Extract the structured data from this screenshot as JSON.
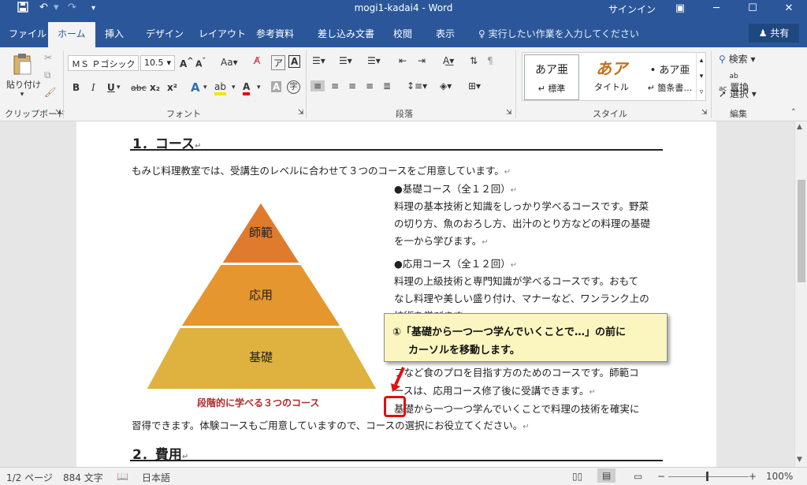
{
  "titlebar": {
    "doc_title": "mogi1-kadai4  -  Word",
    "signin": "サインイン"
  },
  "tabs": [
    "ファイル",
    "ホーム",
    "挿入",
    "デザイン",
    "レイアウト",
    "参考資料",
    "差し込み文書",
    "校閲",
    "表示"
  ],
  "tellme": "実行したい作業を入力してください",
  "share": "共有",
  "ribbon": {
    "clipboard": {
      "paste": "貼り付け",
      "label": "クリップボード"
    },
    "font": {
      "name": "ＭＳ Ｐゴシック",
      "size": "10.5",
      "label": "フォント",
      "aa": "Aa",
      "bold": "B",
      "italic": "I",
      "underline": "U",
      "strike": "abc",
      "sub": "x₂",
      "sup": "x²",
      "text_effects": "A",
      "highlight": "ab",
      "font_color": "A",
      "char_shading": "A",
      "enclose": "字"
    },
    "paragraph": {
      "label": "段落"
    },
    "styles": {
      "label": "スタイル",
      "items": [
        {
          "preview": "あア亜",
          "name": "↵ 標準"
        },
        {
          "preview": "あア",
          "name": "タイトル"
        },
        {
          "preview": "• あア亜",
          "name": "↵ 箇条書…"
        }
      ]
    },
    "editing": {
      "label": "編集",
      "find": "検索",
      "replace": "置換",
      "select": "選択"
    }
  },
  "document": {
    "heading1": "1．コース",
    "intro": "もみじ料理教室では、受講生のレベルに合わせて３つのコースをご用意しています。",
    "course_basic_title": "●基礎コース（全１２回）",
    "course_basic_l1": "料理の基本技術と知識をしっかり学べるコースです。野菜",
    "course_basic_l2": "の切り方、魚のおろし方、出汁のとり方などの料理の基礎",
    "course_basic_l3": "を一から学びます。",
    "course_applied_title": "●応用コース（全１２回）",
    "course_applied_l1": "料理の上級技術と専門知識が学べるコースです。おもて",
    "course_applied_l2": "なし料理や美しい盛り付け、マナーなど、ワンランク上の",
    "course_applied_l3": "技術を学びます。",
    "course_master_l2": "フなど食のプロを目指す方のためのコースです。師範コ",
    "course_master_l3": "ースは、応用コース修了後に受講できます。",
    "closing_l1": "基礎から一つ一つ学んでいくことで料理の技術を確実に",
    "closing_l2": "習得できます。体験コースもご用意していますので、コースの選択にお役立てください。",
    "heading2": "2．費用",
    "pyramid": {
      "levels": [
        "師範",
        "応用",
        "基礎"
      ],
      "caption": "段階的に学べる３つのコース",
      "colors": [
        "#e07b2e",
        "#e5962e",
        "#dfb23f"
      ]
    }
  },
  "callout": {
    "line1": "①「基礎から一つ一つ学んでいくことで…」の前に",
    "line2": "カーソルを移動します。"
  },
  "statusbar": {
    "page": "1/2 ページ",
    "words": "884 文字",
    "language": "日本語",
    "zoom": "100%"
  }
}
